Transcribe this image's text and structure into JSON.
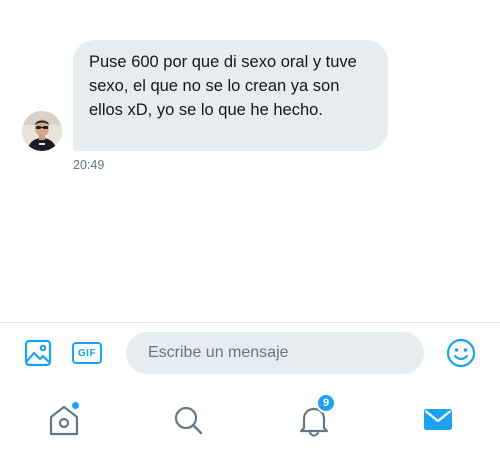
{
  "conversation": {
    "messages": [
      {
        "text": "Puse 600 por que di sexo oral y tuve sexo, el que no se lo crean ya son ellos xD, yo se lo que he hecho.",
        "time": "20:49"
      }
    ]
  },
  "composer": {
    "gif_label": "GIF",
    "placeholder": "Escribe un mensaje",
    "value": ""
  },
  "tabbar": {
    "tabs": [
      {
        "icon": "home-icon",
        "active": false,
        "has_dot": true
      },
      {
        "icon": "search-icon",
        "active": false
      },
      {
        "icon": "bell-icon",
        "active": false,
        "badge": "9"
      },
      {
        "icon": "envelope-icon",
        "active": true
      }
    ]
  },
  "colors": {
    "accent": "#1da1f2",
    "bubble": "#e6ecf0",
    "text": "#14171a",
    "muted": "#657786",
    "inactive_icon": "#657786"
  }
}
